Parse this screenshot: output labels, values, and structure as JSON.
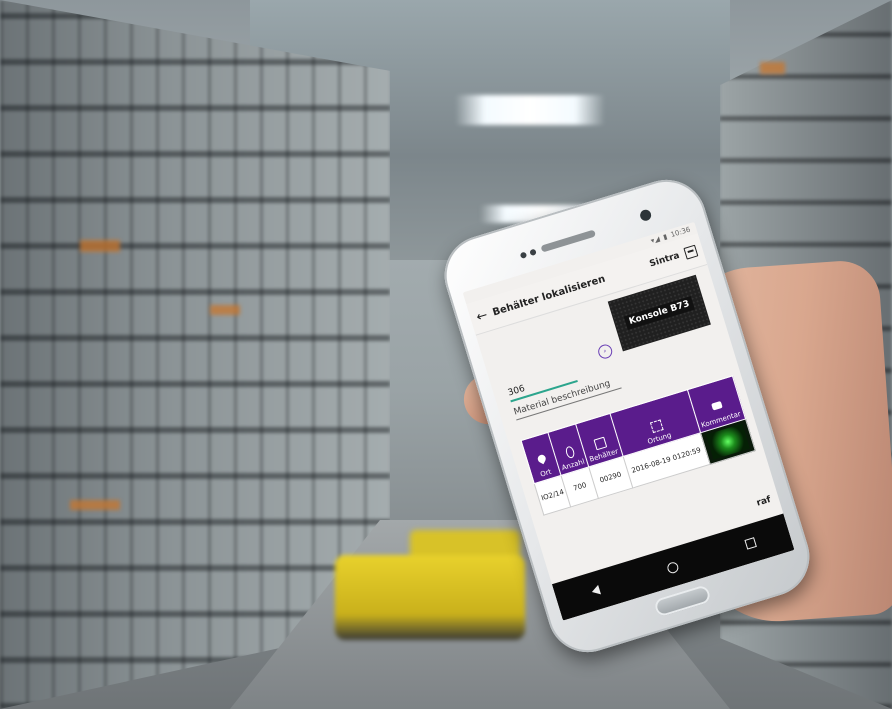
{
  "app": {
    "title": "Behälter lokalisieren",
    "user": "Sintra",
    "status_time": "10:36"
  },
  "form": {
    "konsole_label": "Konsole B73",
    "field_value": "306",
    "field_label": "Material beschreibung"
  },
  "table": {
    "headers": [
      "Ort",
      "Anzahl",
      "Behälter",
      "Ortung",
      "Kommentar"
    ],
    "row": {
      "ort": "IO2/14",
      "anzahl": "700",
      "behaelter": "00290",
      "datum": "2016-08-19 0120:59"
    }
  },
  "brand": "raf",
  "colors": {
    "header_purple": "#5a1c8c",
    "accent_teal": "#2ca58d"
  }
}
